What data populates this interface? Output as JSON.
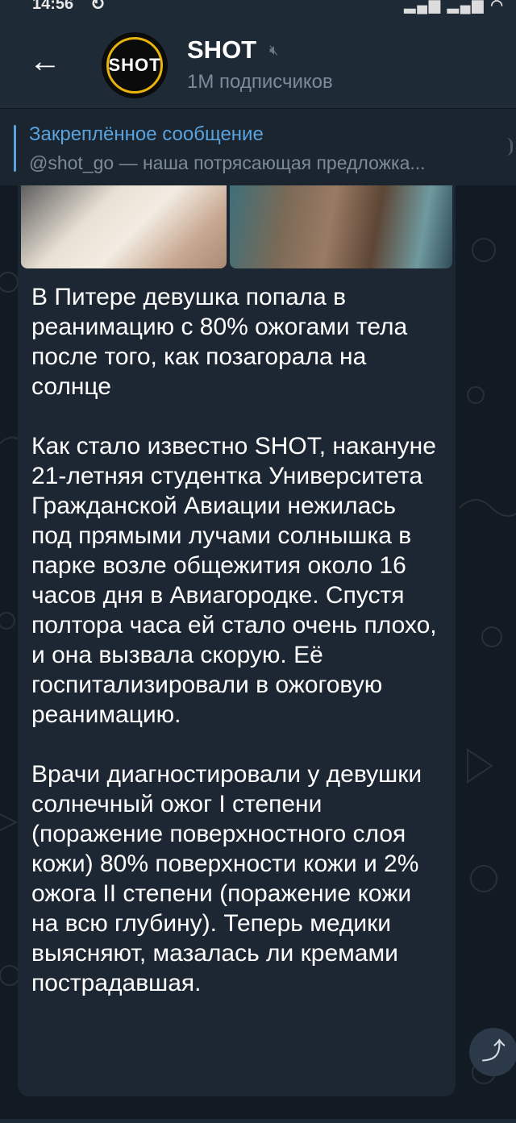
{
  "statusbar": {
    "time": "14:56",
    "sync_icon": "sync-icon",
    "signal_wifi_icons": "signal-icon wifi-icon"
  },
  "header": {
    "back_icon": "arrow-left-icon",
    "avatar_text": "SHOT",
    "title": "SHOT",
    "mute_icon": "mute-icon",
    "subscribers": "1M подписчиков"
  },
  "pinned": {
    "title": "Закреплённое сообщение",
    "text": "@shot_go — наша потрясающая предложка..."
  },
  "message": {
    "text": "В Питере девушка попала в реанимацию с 80% ожогами тела после того, как позагорала на солнце\n\nКак стало известно SHOT, накануне 21-летняя студентка Университета Гражданской Авиации нежилась под прямыми лучами солнышка в парке возле общежития около 16 часов дня в Авиагородке. Спустя полтора часа ей стало очень плохо, и она вызвала скорую. Её госпитализировали в ожоговую реанимацию.\n\nВрачи диагностировали у девушки солнечный ожог I степени (поражение поверхностного слоя кожи) 80% поверхности кожи и 2% ожога II степени (поражение кожи на всю глубину). Теперь медики выясняют, мазалась ли кремами пострадавшая."
  },
  "share_icon": "share-icon",
  "colors": {
    "header_bg": "#1f2a37",
    "accent": "#5aa3de",
    "bubble_bg": "#1c2733",
    "chat_bg": "#121a23"
  }
}
